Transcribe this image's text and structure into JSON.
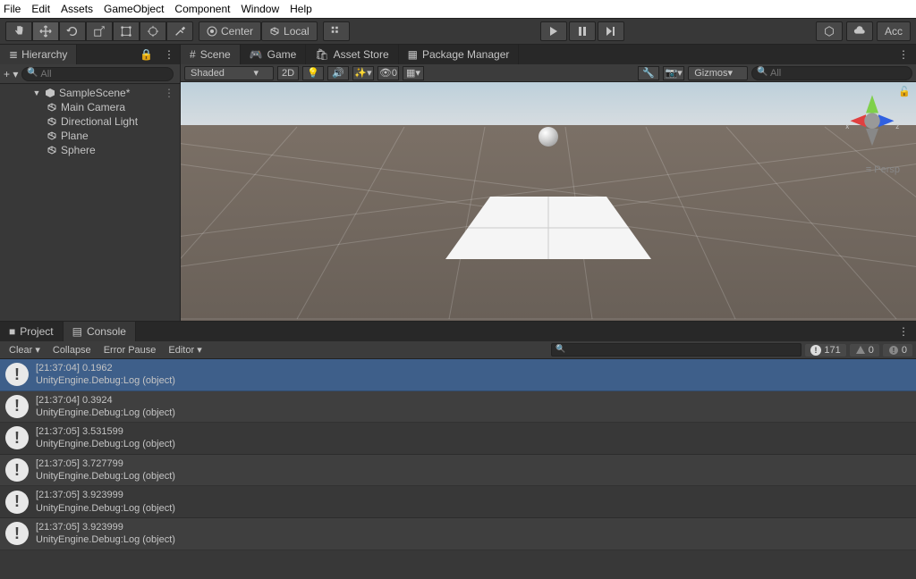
{
  "menubar": [
    "File",
    "Edit",
    "Assets",
    "GameObject",
    "Component",
    "Window",
    "Help"
  ],
  "toolbar": {
    "pivot_label": "Center",
    "handle_label": "Local",
    "account_label": "Acc"
  },
  "hierarchy": {
    "title": "Hierarchy",
    "search_placeholder": "All",
    "scene_name": "SampleScene*",
    "objects": [
      "Main Camera",
      "Directional Light",
      "Plane",
      "Sphere"
    ]
  },
  "scene_tabs": {
    "scene": "Scene",
    "game": "Game",
    "asset_store": "Asset Store",
    "package_manager": "Package Manager"
  },
  "scene_toolbar": {
    "shading": "Shaded",
    "mode_2d": "2D",
    "gizmos": "Gizmos",
    "search_placeholder": "All"
  },
  "viewport": {
    "axis_x": "x",
    "axis_z": "z",
    "projection": "Persp"
  },
  "bottom_tabs": {
    "project": "Project",
    "console": "Console"
  },
  "console_toolbar": {
    "clear": "Clear",
    "collapse": "Collapse",
    "error_pause": "Error Pause",
    "editor": "Editor",
    "info_count": "171",
    "warn_count": "0",
    "error_count": "0"
  },
  "console_entries": [
    {
      "line1": "[21:37:04] 0.1962",
      "line2": "UnityEngine.Debug:Log (object)",
      "selected": true
    },
    {
      "line1": "[21:37:04] 0.3924",
      "line2": "UnityEngine.Debug:Log (object)",
      "selected": false
    },
    {
      "line1": "[21:37:05] 3.531599",
      "line2": "UnityEngine.Debug:Log (object)",
      "selected": false
    },
    {
      "line1": "[21:37:05] 3.727799",
      "line2": "UnityEngine.Debug:Log (object)",
      "selected": false
    },
    {
      "line1": "[21:37:05] 3.923999",
      "line2": "UnityEngine.Debug:Log (object)",
      "selected": false
    },
    {
      "line1": "[21:37:05] 3.923999",
      "line2": "UnityEngine.Debug:Log (object)",
      "selected": false
    }
  ]
}
